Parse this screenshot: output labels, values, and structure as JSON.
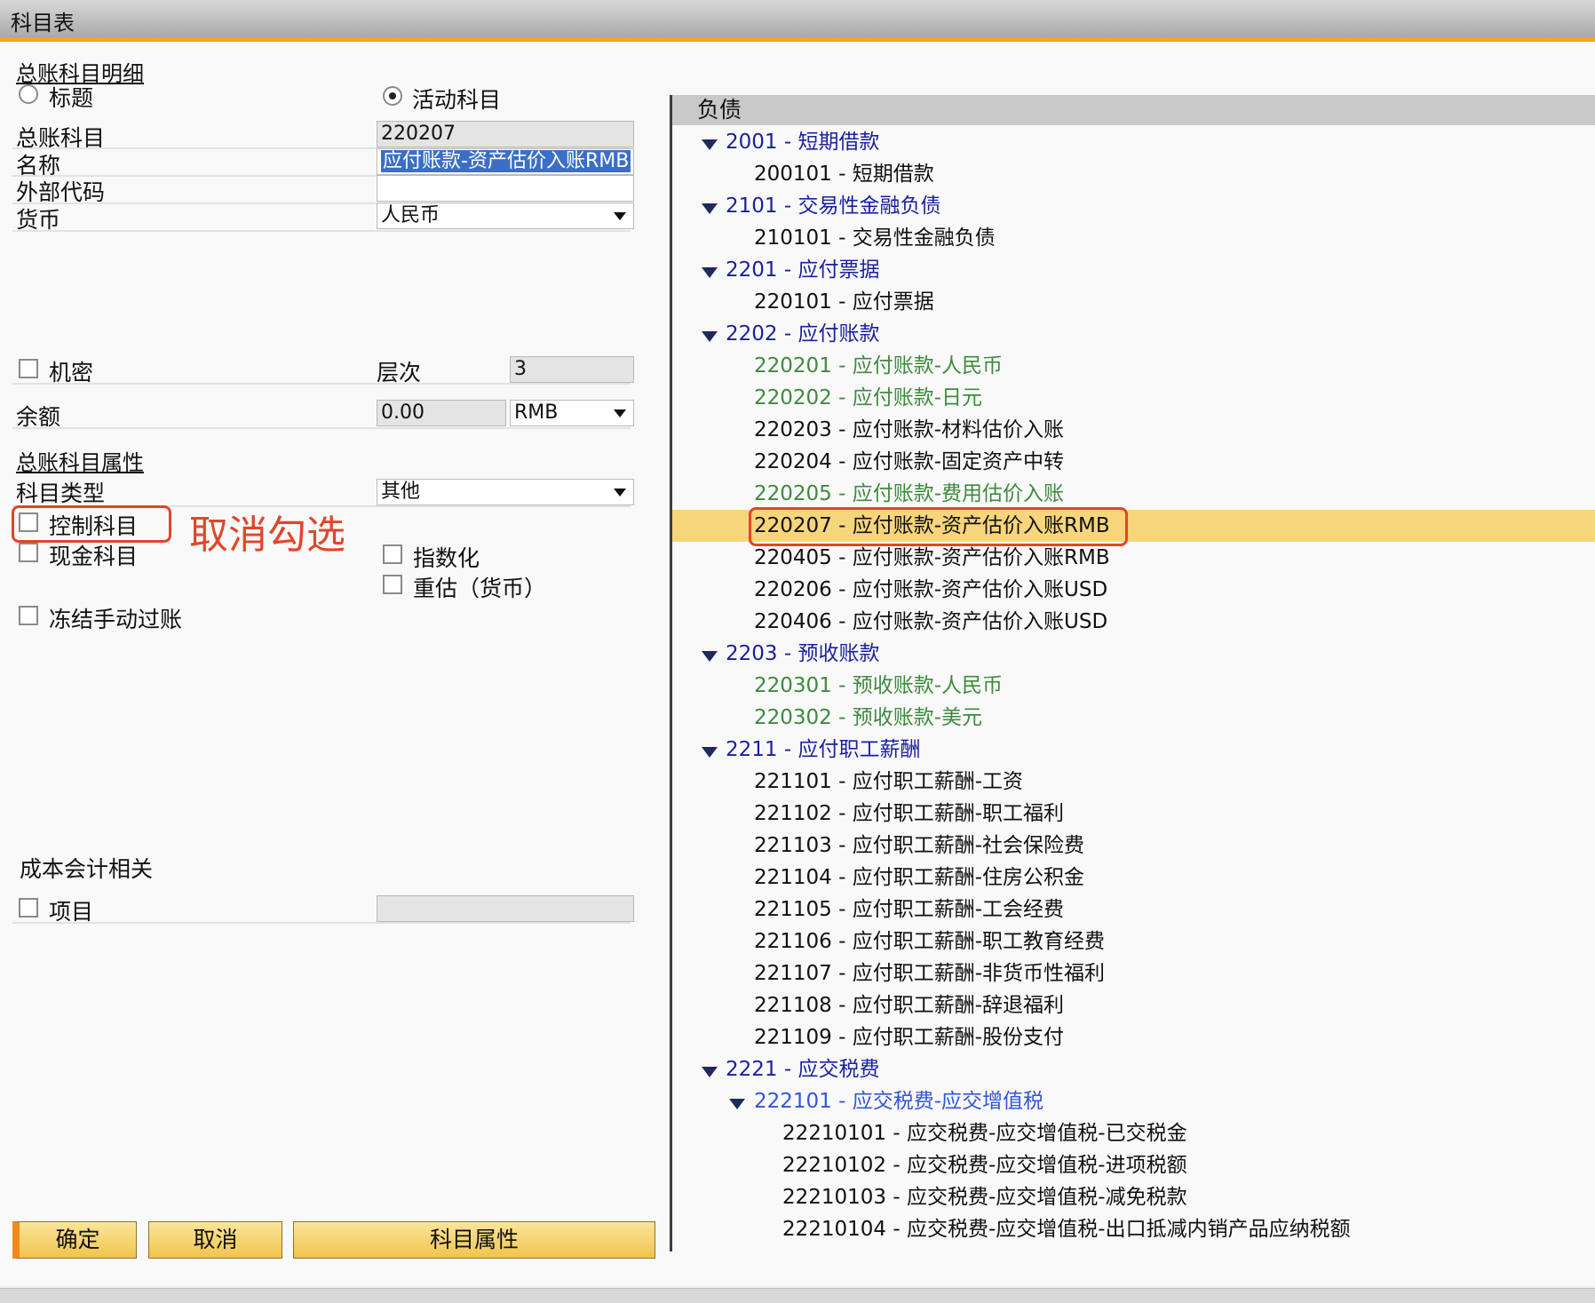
{
  "window": {
    "title": "科目表"
  },
  "left": {
    "section_details": "总账科目明细",
    "radio_title": "标题",
    "radio_active": "活动科目",
    "gl_account_label": "总账科目",
    "gl_account_value": "220207",
    "name_label": "名称",
    "name_value": "应付账款-资产估价入账RMB",
    "ext_code_label": "外部代码",
    "ext_code_value": "",
    "currency_label": "货币",
    "currency_value": "人民币",
    "confidential_label": "机密",
    "level_label": "层次",
    "level_value": "3",
    "balance_label": "余额",
    "balance_value": "0.00",
    "balance_currency": "RMB",
    "section_props": "总账科目属性",
    "acct_type_label": "科目类型",
    "acct_type_value": "其他",
    "control_account_label": "控制科目",
    "annotation": "取消勾选",
    "cash_account_label": "现金科目",
    "indexed_label": "指数化",
    "revaluation_label": "重估（货币）",
    "block_manual_label": "冻结手动过账",
    "cost_section": "成本会计相关",
    "project_label": "项目",
    "project_value": ""
  },
  "buttons": {
    "ok": "确定",
    "cancel": "取消",
    "props": "科目属性"
  },
  "tree": {
    "header": "负债",
    "nodes": [
      "2001 - 短期借款",
      "200101 - 短期借款",
      "2101 - 交易性金融负债",
      "210101 - 交易性金融负债",
      "2201 - 应付票据",
      "220101 - 应付票据",
      "2202 - 应付账款",
      "220201 - 应付账款-人民币",
      "220202 - 应付账款-日元",
      "220203 - 应付账款-材料估价入账",
      "220204 - 应付账款-固定资产中转",
      "220205 - 应付账款-费用估价入账",
      "220207 - 应付账款-资产估价入账RMB",
      "220405 - 应付账款-资产估价入账RMB",
      "220206 - 应付账款-资产估价入账USD",
      "220406 - 应付账款-资产估价入账USD",
      "2203 - 预收账款",
      "220301 - 预收账款-人民币",
      "220302 - 预收账款-美元",
      "2211 - 应付职工薪酬",
      "221101 - 应付职工薪酬-工资",
      "221102 - 应付职工薪酬-职工福利",
      "221103 - 应付职工薪酬-社会保险费",
      "221104 - 应付职工薪酬-住房公积金",
      "221105 - 应付职工薪酬-工会经费",
      "221106 - 应付职工薪酬-职工教育经费",
      "221107 - 应付职工薪酬-非货币性福利",
      "221108 - 应付职工薪酬-辞退福利",
      "221109 - 应付职工薪酬-股份支付",
      "2221 - 应交税费",
      "222101 - 应交税费-应交增值税",
      "22210101 - 应交税费-应交增值税-已交税金",
      "22210102 - 应交税费-应交增值税-进项税额",
      "22210103 - 应交税费-应交增值税-减免税款",
      "22210104 - 应交税费-应交增值税-出口抵减内销产品应纳税额"
    ]
  }
}
